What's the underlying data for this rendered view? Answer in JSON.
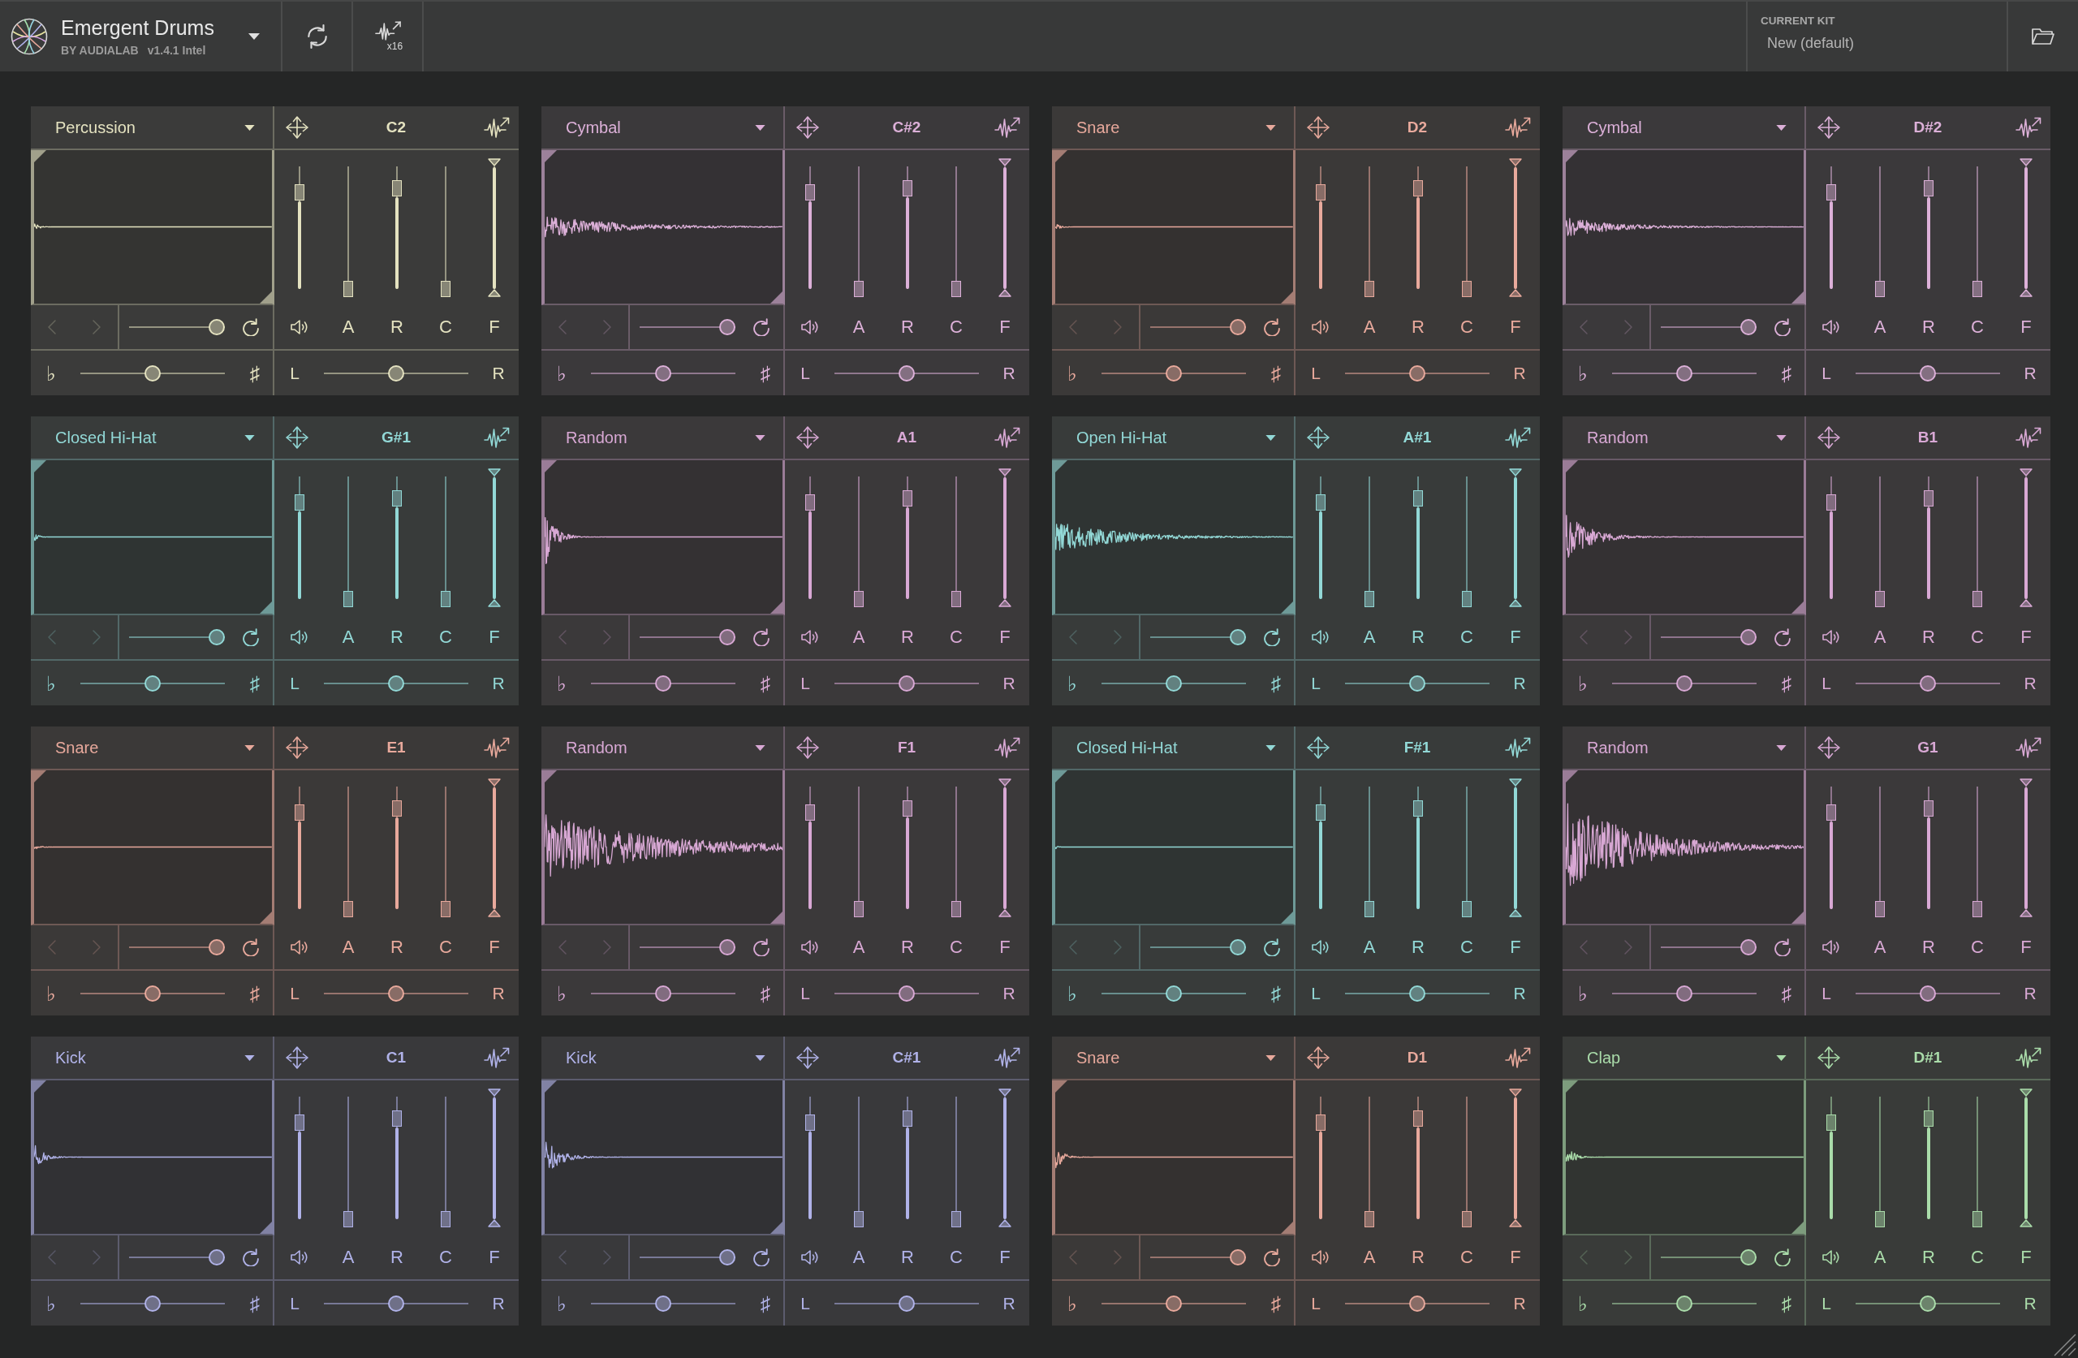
{
  "app": {
    "title": "Emergent Drums",
    "maker": "BY AUDIALAB",
    "version": "v1.4.1 Intel",
    "export_count": "x16",
    "kit_label": "CURRENT KIT",
    "kit_name": "New (default)"
  },
  "pads": [
    {
      "type": "Percussion",
      "note": "C2",
      "color": "#e4e2c0",
      "faders": [
        {
          "kind": "volume",
          "level": 0.79
        },
        {
          "kind": "fader",
          "label": "A",
          "level": 0
        },
        {
          "kind": "fader",
          "label": "R",
          "level": 0.82
        },
        {
          "kind": "fader",
          "label": "C",
          "level": 0
        },
        {
          "kind": "range",
          "label": "F",
          "level": 1
        }
      ],
      "sample_slider": {
        "level": 1
      },
      "pitch": {
        "low": "♭",
        "high": "♯",
        "level": 0.5
      },
      "pan": {
        "low": "L",
        "high": "R",
        "level": 0.5
      }
    },
    {
      "type": "Cymbal",
      "note": "C#2",
      "color": "#dcb0d8",
      "faders": [
        {
          "kind": "volume",
          "level": 0.79
        },
        {
          "kind": "fader",
          "label": "A",
          "level": 0
        },
        {
          "kind": "fader",
          "label": "R",
          "level": 0.82
        },
        {
          "kind": "fader",
          "label": "C",
          "level": 0
        },
        {
          "kind": "range",
          "label": "F",
          "level": 1
        }
      ],
      "sample_slider": {
        "level": 1
      },
      "pitch": {
        "low": "♭",
        "high": "♯",
        "level": 0.5
      },
      "pan": {
        "low": "L",
        "high": "R",
        "level": 0.5
      }
    },
    {
      "type": "Snare",
      "note": "D2",
      "color": "#e8a99c",
      "faders": [
        {
          "kind": "volume",
          "level": 0.79
        },
        {
          "kind": "fader",
          "label": "A",
          "level": 0
        },
        {
          "kind": "fader",
          "label": "R",
          "level": 0.82
        },
        {
          "kind": "fader",
          "label": "C",
          "level": 0
        },
        {
          "kind": "range",
          "label": "F",
          "level": 1
        }
      ],
      "sample_slider": {
        "level": 1
      },
      "pitch": {
        "low": "♭",
        "high": "♯",
        "level": 0.5
      },
      "pan": {
        "low": "L",
        "high": "R",
        "level": 0.5
      }
    },
    {
      "type": "Cymbal",
      "note": "D#2",
      "color": "#dcb0d8",
      "faders": [
        {
          "kind": "volume",
          "level": 0.79
        },
        {
          "kind": "fader",
          "label": "A",
          "level": 0
        },
        {
          "kind": "fader",
          "label": "R",
          "level": 0.82
        },
        {
          "kind": "fader",
          "label": "C",
          "level": 0
        },
        {
          "kind": "range",
          "label": "F",
          "level": 1
        }
      ],
      "sample_slider": {
        "level": 1
      },
      "pitch": {
        "low": "♭",
        "high": "♯",
        "level": 0.5
      },
      "pan": {
        "low": "L",
        "high": "R",
        "level": 0.5
      }
    },
    {
      "type": "Closed Hi-Hat",
      "note": "G#1",
      "color": "#92d8d6",
      "faders": [
        {
          "kind": "volume",
          "level": 0.79
        },
        {
          "kind": "fader",
          "label": "A",
          "level": 0
        },
        {
          "kind": "fader",
          "label": "R",
          "level": 0.82
        },
        {
          "kind": "fader",
          "label": "C",
          "level": 0
        },
        {
          "kind": "range",
          "label": "F",
          "level": 1
        }
      ],
      "sample_slider": {
        "level": 1
      },
      "pitch": {
        "low": "♭",
        "high": "♯",
        "level": 0.5
      },
      "pan": {
        "low": "L",
        "high": "R",
        "level": 0.5
      }
    },
    {
      "type": "Random",
      "note": "A1",
      "color": "#d8a8d4",
      "faders": [
        {
          "kind": "volume",
          "level": 0.79
        },
        {
          "kind": "fader",
          "label": "A",
          "level": 0
        },
        {
          "kind": "fader",
          "label": "R",
          "level": 0.82
        },
        {
          "kind": "fader",
          "label": "C",
          "level": 0
        },
        {
          "kind": "range",
          "label": "F",
          "level": 1
        }
      ],
      "sample_slider": {
        "level": 1
      },
      "pitch": {
        "low": "♭",
        "high": "♯",
        "level": 0.5
      },
      "pan": {
        "low": "L",
        "high": "R",
        "level": 0.5
      }
    },
    {
      "type": "Open Hi-Hat",
      "note": "A#1",
      "color": "#92d8d6",
      "faders": [
        {
          "kind": "volume",
          "level": 0.79
        },
        {
          "kind": "fader",
          "label": "A",
          "level": 0
        },
        {
          "kind": "fader",
          "label": "R",
          "level": 0.82
        },
        {
          "kind": "fader",
          "label": "C",
          "level": 0
        },
        {
          "kind": "range",
          "label": "F",
          "level": 1
        }
      ],
      "sample_slider": {
        "level": 1
      },
      "pitch": {
        "low": "♭",
        "high": "♯",
        "level": 0.5
      },
      "pan": {
        "low": "L",
        "high": "R",
        "level": 0.5
      }
    },
    {
      "type": "Random",
      "note": "B1",
      "color": "#d8a8d4",
      "faders": [
        {
          "kind": "volume",
          "level": 0.79
        },
        {
          "kind": "fader",
          "label": "A",
          "level": 0
        },
        {
          "kind": "fader",
          "label": "R",
          "level": 0.82
        },
        {
          "kind": "fader",
          "label": "C",
          "level": 0
        },
        {
          "kind": "range",
          "label": "F",
          "level": 1
        }
      ],
      "sample_slider": {
        "level": 1
      },
      "pitch": {
        "low": "♭",
        "high": "♯",
        "level": 0.5
      },
      "pan": {
        "low": "L",
        "high": "R",
        "level": 0.5
      }
    },
    {
      "type": "Snare",
      "note": "E1",
      "color": "#e8a99c",
      "faders": [
        {
          "kind": "volume",
          "level": 0.79
        },
        {
          "kind": "fader",
          "label": "A",
          "level": 0
        },
        {
          "kind": "fader",
          "label": "R",
          "level": 0.82
        },
        {
          "kind": "fader",
          "label": "C",
          "level": 0
        },
        {
          "kind": "range",
          "label": "F",
          "level": 1
        }
      ],
      "sample_slider": {
        "level": 1
      },
      "pitch": {
        "low": "♭",
        "high": "♯",
        "level": 0.5
      },
      "pan": {
        "low": "L",
        "high": "R",
        "level": 0.5
      }
    },
    {
      "type": "Random",
      "note": "F1",
      "color": "#d8a8d4",
      "faders": [
        {
          "kind": "volume",
          "level": 0.79
        },
        {
          "kind": "fader",
          "label": "A",
          "level": 0
        },
        {
          "kind": "fader",
          "label": "R",
          "level": 0.82
        },
        {
          "kind": "fader",
          "label": "C",
          "level": 0
        },
        {
          "kind": "range",
          "label": "F",
          "level": 1
        }
      ],
      "sample_slider": {
        "level": 1
      },
      "pitch": {
        "low": "♭",
        "high": "♯",
        "level": 0.5
      },
      "pan": {
        "low": "L",
        "high": "R",
        "level": 0.5
      }
    },
    {
      "type": "Closed Hi-Hat",
      "note": "F#1",
      "color": "#92d8d6",
      "faders": [
        {
          "kind": "volume",
          "level": 0.79
        },
        {
          "kind": "fader",
          "label": "A",
          "level": 0
        },
        {
          "kind": "fader",
          "label": "R",
          "level": 0.82
        },
        {
          "kind": "fader",
          "label": "C",
          "level": 0
        },
        {
          "kind": "range",
          "label": "F",
          "level": 1
        }
      ],
      "sample_slider": {
        "level": 1
      },
      "pitch": {
        "low": "♭",
        "high": "♯",
        "level": 0.5
      },
      "pan": {
        "low": "L",
        "high": "R",
        "level": 0.5
      }
    },
    {
      "type": "Random",
      "note": "G1",
      "color": "#d8a8d4",
      "faders": [
        {
          "kind": "volume",
          "level": 0.79
        },
        {
          "kind": "fader",
          "label": "A",
          "level": 0
        },
        {
          "kind": "fader",
          "label": "R",
          "level": 0.82
        },
        {
          "kind": "fader",
          "label": "C",
          "level": 0
        },
        {
          "kind": "range",
          "label": "F",
          "level": 1
        }
      ],
      "sample_slider": {
        "level": 1
      },
      "pitch": {
        "low": "♭",
        "high": "♯",
        "level": 0.5
      },
      "pan": {
        "low": "L",
        "high": "R",
        "level": 0.5
      }
    },
    {
      "type": "Kick",
      "note": "C1",
      "color": "#b0b2e8",
      "faders": [
        {
          "kind": "volume",
          "level": 0.79
        },
        {
          "kind": "fader",
          "label": "A",
          "level": 0
        },
        {
          "kind": "fader",
          "label": "R",
          "level": 0.82
        },
        {
          "kind": "fader",
          "label": "C",
          "level": 0
        },
        {
          "kind": "range",
          "label": "F",
          "level": 1
        }
      ],
      "sample_slider": {
        "level": 1
      },
      "pitch": {
        "low": "♭",
        "high": "♯",
        "level": 0.5
      },
      "pan": {
        "low": "L",
        "high": "R",
        "level": 0.5
      }
    },
    {
      "type": "Kick",
      "note": "C#1",
      "color": "#b0b2e8",
      "faders": [
        {
          "kind": "volume",
          "level": 0.79
        },
        {
          "kind": "fader",
          "label": "A",
          "level": 0
        },
        {
          "kind": "fader",
          "label": "R",
          "level": 0.82
        },
        {
          "kind": "fader",
          "label": "C",
          "level": 0
        },
        {
          "kind": "range",
          "label": "F",
          "level": 1
        }
      ],
      "sample_slider": {
        "level": 1
      },
      "pitch": {
        "low": "♭",
        "high": "♯",
        "level": 0.5
      },
      "pan": {
        "low": "L",
        "high": "R",
        "level": 0.5
      }
    },
    {
      "type": "Snare",
      "note": "D1",
      "color": "#e8a99c",
      "faders": [
        {
          "kind": "volume",
          "level": 0.79
        },
        {
          "kind": "fader",
          "label": "A",
          "level": 0
        },
        {
          "kind": "fader",
          "label": "R",
          "level": 0.82
        },
        {
          "kind": "fader",
          "label": "C",
          "level": 0
        },
        {
          "kind": "range",
          "label": "F",
          "level": 1
        }
      ],
      "sample_slider": {
        "level": 1
      },
      "pitch": {
        "low": "♭",
        "high": "♯",
        "level": 0.5
      },
      "pan": {
        "low": "L",
        "high": "R",
        "level": 0.5
      }
    },
    {
      "type": "Clap",
      "note": "D#1",
      "color": "#aadcaa",
      "faders": [
        {
          "kind": "volume",
          "level": 0.79
        },
        {
          "kind": "fader",
          "label": "A",
          "level": 0
        },
        {
          "kind": "fader",
          "label": "R",
          "level": 0.82
        },
        {
          "kind": "fader",
          "label": "C",
          "level": 0
        },
        {
          "kind": "range",
          "label": "F",
          "level": 1
        }
      ],
      "sample_slider": {
        "level": 1
      },
      "pitch": {
        "low": "♭",
        "high": "♯",
        "level": 0.5
      },
      "pan": {
        "low": "L",
        "high": "R",
        "level": 0.5
      }
    }
  ]
}
